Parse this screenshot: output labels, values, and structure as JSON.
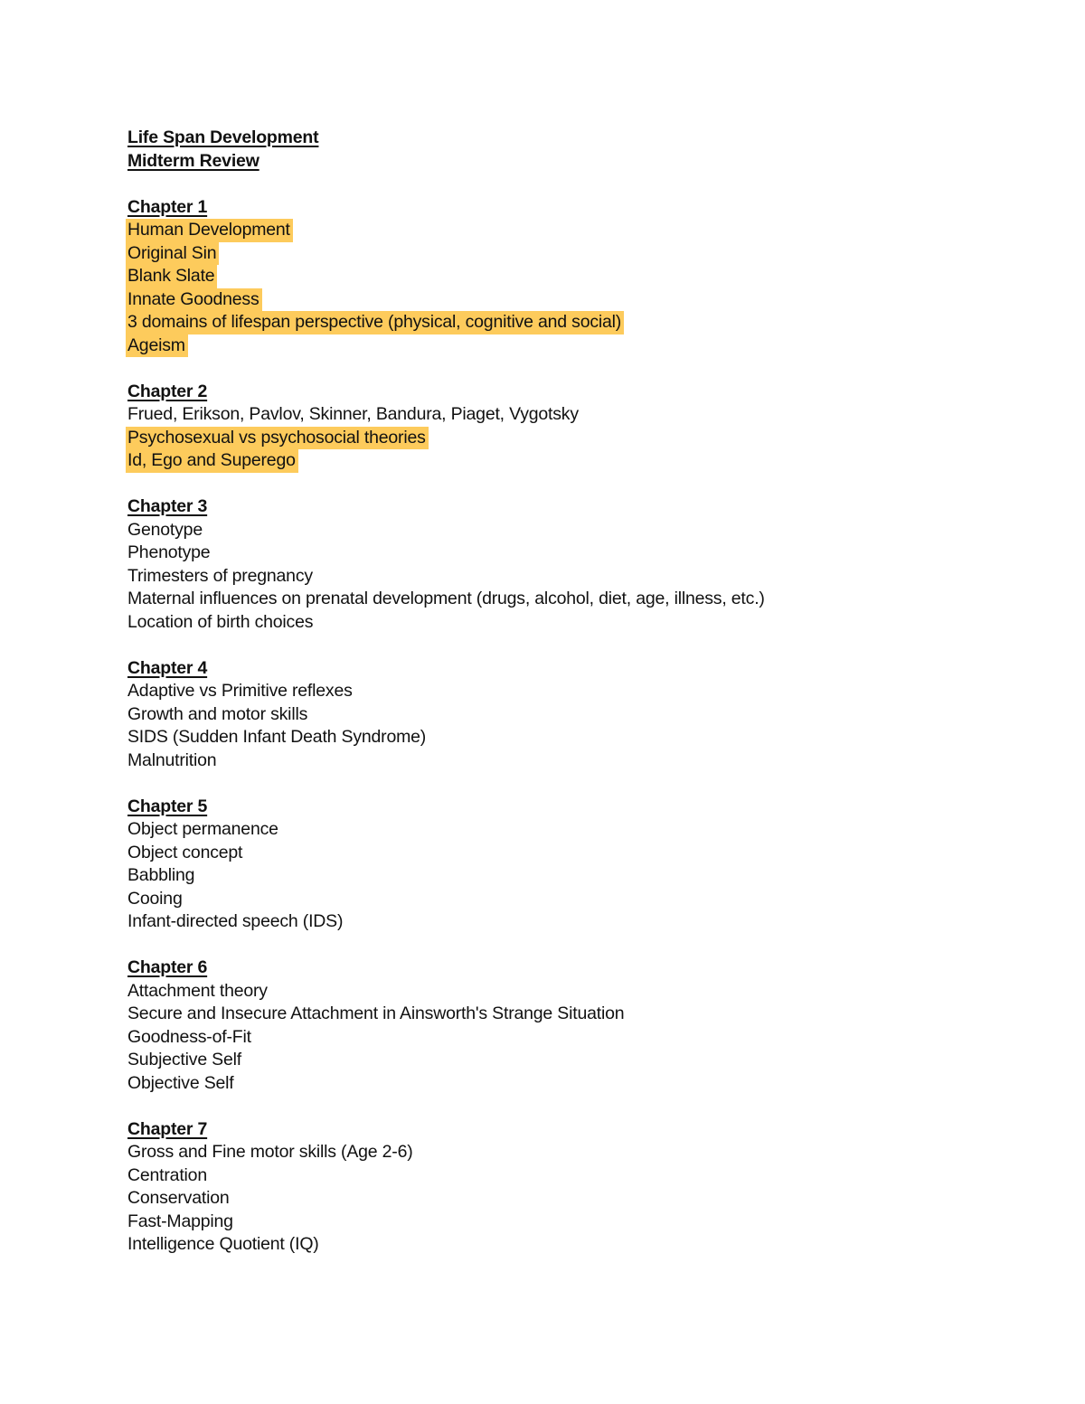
{
  "document": {
    "title": "Life Span Development",
    "subtitle": "Midterm Review",
    "highlight_color": "#fdcb5c",
    "chapters": [
      {
        "heading": "Chapter 1",
        "items": [
          {
            "text": "Human Development",
            "highlighted": true
          },
          {
            "text": "Original Sin",
            "highlighted": true
          },
          {
            "text": "Blank Slate",
            "highlighted": true
          },
          {
            "text": "Innate Goodness",
            "highlighted": true
          },
          {
            "text": "3 domains of lifespan perspective (physical, cognitive and social)",
            "highlighted": true
          },
          {
            "text": "Ageism",
            "highlighted": true
          }
        ]
      },
      {
        "heading": "Chapter 2",
        "items": [
          {
            "text": "Frued, Erikson, Pavlov, Skinner, Bandura, Piaget, Vygotsky",
            "highlighted": false
          },
          {
            "text": "Psychosexual vs psychosocial theories",
            "highlighted": true
          },
          {
            "text": "Id, Ego and Superego",
            "highlighted": true
          }
        ]
      },
      {
        "heading": "Chapter 3",
        "items": [
          {
            "text": "Genotype",
            "highlighted": false
          },
          {
            "text": "Phenotype",
            "highlighted": false
          },
          {
            "text": "Trimesters of pregnancy",
            "highlighted": false
          },
          {
            "text": "Maternal influences on prenatal development (drugs, alcohol, diet, age, illness, etc.)",
            "highlighted": false
          },
          {
            "text": "Location of birth choices",
            "highlighted": false
          }
        ]
      },
      {
        "heading": "Chapter 4",
        "items": [
          {
            "text": "Adaptive vs Primitive reflexes",
            "highlighted": false
          },
          {
            "text": "Growth and motor skills",
            "highlighted": false
          },
          {
            "text": "SIDS (Sudden Infant Death Syndrome)",
            "highlighted": false
          },
          {
            "text": "Malnutrition",
            "highlighted": false
          }
        ]
      },
      {
        "heading": "Chapter 5",
        "items": [
          {
            "text": "Object permanence",
            "highlighted": false
          },
          {
            "text": "Object concept",
            "highlighted": false
          },
          {
            "text": "Babbling",
            "highlighted": false
          },
          {
            "text": "Cooing",
            "highlighted": false
          },
          {
            "text": "Infant-directed speech (IDS)",
            "highlighted": false
          }
        ]
      },
      {
        "heading": "Chapter 6",
        "items": [
          {
            "text": "Attachment theory",
            "highlighted": false
          },
          {
            "text": "Secure and Insecure Attachment in Ainsworth's Strange Situation",
            "highlighted": false
          },
          {
            "text": "Goodness-of-Fit",
            "highlighted": false
          },
          {
            "text": "Subjective Self",
            "highlighted": false
          },
          {
            "text": "Objective Self",
            "highlighted": false
          }
        ]
      },
      {
        "heading": "Chapter 7",
        "items": [
          {
            "text": "Gross and Fine motor skills (Age 2-6)",
            "highlighted": false
          },
          {
            "text": "Centration",
            "highlighted": false
          },
          {
            "text": "Conservation",
            "highlighted": false
          },
          {
            "text": "Fast-Mapping",
            "highlighted": false
          },
          {
            "text": "Intelligence Quotient (IQ)",
            "highlighted": false
          }
        ]
      }
    ]
  }
}
